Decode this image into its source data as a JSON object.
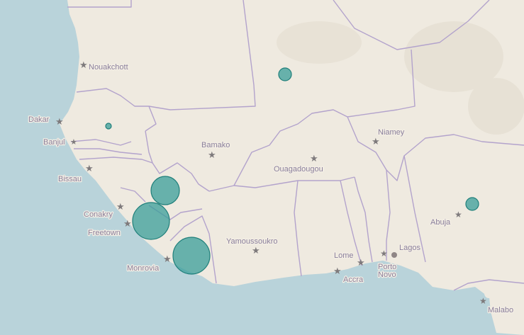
{
  "map": {
    "colors": {
      "water": "#b9d3da",
      "land": "#efeae0",
      "border": "#b3a3cc",
      "bubble_fill": "#3a9e9a",
      "bubble_stroke": "#1f7f7a",
      "label": "#8a7f9c",
      "star": "#7e7a7c"
    },
    "cities": [
      {
        "id": "nouakchott",
        "name": "Nouakchott",
        "marker": "star-icon"
      },
      {
        "id": "dakar",
        "name": "Dakar",
        "marker": "star-icon"
      },
      {
        "id": "banjul",
        "name": "Banjul",
        "marker": "star-icon"
      },
      {
        "id": "bissau",
        "name": "Bissau",
        "marker": "star-icon"
      },
      {
        "id": "conakry",
        "name": "Conakry",
        "marker": "star-icon"
      },
      {
        "id": "freetown",
        "name": "Freetown",
        "marker": "star-icon"
      },
      {
        "id": "monrovia",
        "name": "Monrovia",
        "marker": "star-icon"
      },
      {
        "id": "bamako",
        "name": "Bamako",
        "marker": "star-icon"
      },
      {
        "id": "ouagadougou",
        "name": "Ouagadougou",
        "marker": "star-icon"
      },
      {
        "id": "niamey",
        "name": "Niamey",
        "marker": "star-icon"
      },
      {
        "id": "yamoussoukro",
        "name": "Yamoussoukro",
        "marker": "star-icon"
      },
      {
        "id": "lome",
        "name": "Lome",
        "marker": "star-icon"
      },
      {
        "id": "accra",
        "name": "Accra",
        "marker": "star-icon"
      },
      {
        "id": "porto_novo",
        "name": "Porto Novo",
        "marker": "star-icon"
      },
      {
        "id": "lagos",
        "name": "Lagos",
        "marker": "dot-icon"
      },
      {
        "id": "abuja",
        "name": "Abuja",
        "marker": "star-icon"
      },
      {
        "id": "malabo",
        "name": "Malabo",
        "marker": "star-icon"
      }
    ],
    "bubbles": [
      {
        "id": "mali-north",
        "relative_size": "small"
      },
      {
        "id": "senegal",
        "relative_size": "tiny"
      },
      {
        "id": "guinea",
        "relative_size": "large"
      },
      {
        "id": "sierra-leone",
        "relative_size": "largest"
      },
      {
        "id": "liberia",
        "relative_size": "largest"
      },
      {
        "id": "nigeria",
        "relative_size": "small"
      }
    ]
  }
}
